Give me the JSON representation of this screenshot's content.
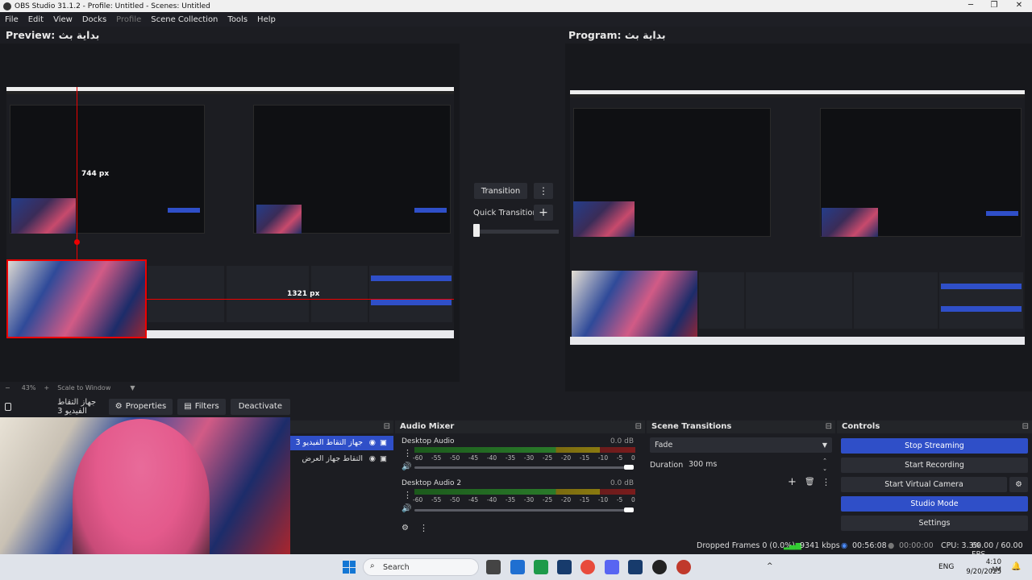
{
  "window": {
    "title": "OBS Studio 31.1.2 - Profile: Untitled - Scenes: Untitled",
    "minimize": "─",
    "maximize": "❐",
    "close": "✕"
  },
  "menu": {
    "file": "File",
    "edit": "Edit",
    "view": "View",
    "docks": "Docks",
    "profile": "Profile",
    "scene_collection": "Scene Collection",
    "tools": "Tools",
    "help": "Help"
  },
  "preview": {
    "title": "Preview: بداية بث",
    "measure_v": "744 px",
    "measure_h": "1321 px"
  },
  "program": {
    "title": "Program: بداية بث"
  },
  "transition_panel": {
    "transition_label": "Transition",
    "quick_transitions_label": "Quick Transitions",
    "more": "⋮",
    "add": "+"
  },
  "zoom": {
    "minus": "−",
    "level": "43%",
    "plus": "+",
    "scale_label": "Scale to Window",
    "caret": "▼"
  },
  "source_bar": {
    "source_name": "جهاز التقاط الفيديو 3",
    "properties": "Properties",
    "filters": "Filters",
    "deactivate": "Deactivate"
  },
  "scenes": {
    "items": [
      {
        "label": "جهاز التقاط الفيديو 3",
        "selected": true
      },
      {
        "label": "التقاط جهاز العرض",
        "selected": false
      }
    ]
  },
  "audio_mixer": {
    "title": "Audio Mixer",
    "channels": [
      {
        "name": "Desktop Audio",
        "db": "0.0 dB"
      },
      {
        "name": "Desktop Audio 2",
        "db": "0.0 dB"
      }
    ],
    "ticks": [
      "-60",
      "-55",
      "-50",
      "-45",
      "-40",
      "-35",
      "-30",
      "-25",
      "-20",
      "-15",
      "-10",
      "-5",
      "0"
    ]
  },
  "scene_transitions": {
    "title": "Scene Transitions",
    "type": "Fade",
    "duration_label": "Duration",
    "duration_value": "300 ms"
  },
  "controls": {
    "title": "Controls",
    "stop_streaming": "Stop Streaming",
    "start_recording": "Start Recording",
    "start_virtual_camera": "Start Virtual Camera",
    "studio_mode": "Studio Mode",
    "settings": "Settings"
  },
  "status": {
    "dropped_frames": "Dropped Frames 0 (0.0%)",
    "bitrate": "9341 kbps",
    "stream_time": "00:56:08",
    "record_time": "00:00:00",
    "cpu": "CPU: 3.3%",
    "fps": "60.00 / 60.00 FPS"
  },
  "taskbar": {
    "search_placeholder": "Search",
    "language": "ENG",
    "time": "4:10 AM",
    "date": "9/20/2025",
    "caret": "^"
  },
  "colors": {
    "accent_blue": "#2f4fc8",
    "background": "#1c1d22",
    "preview_bg": "#17181c",
    "selection_red": "#e00000"
  }
}
